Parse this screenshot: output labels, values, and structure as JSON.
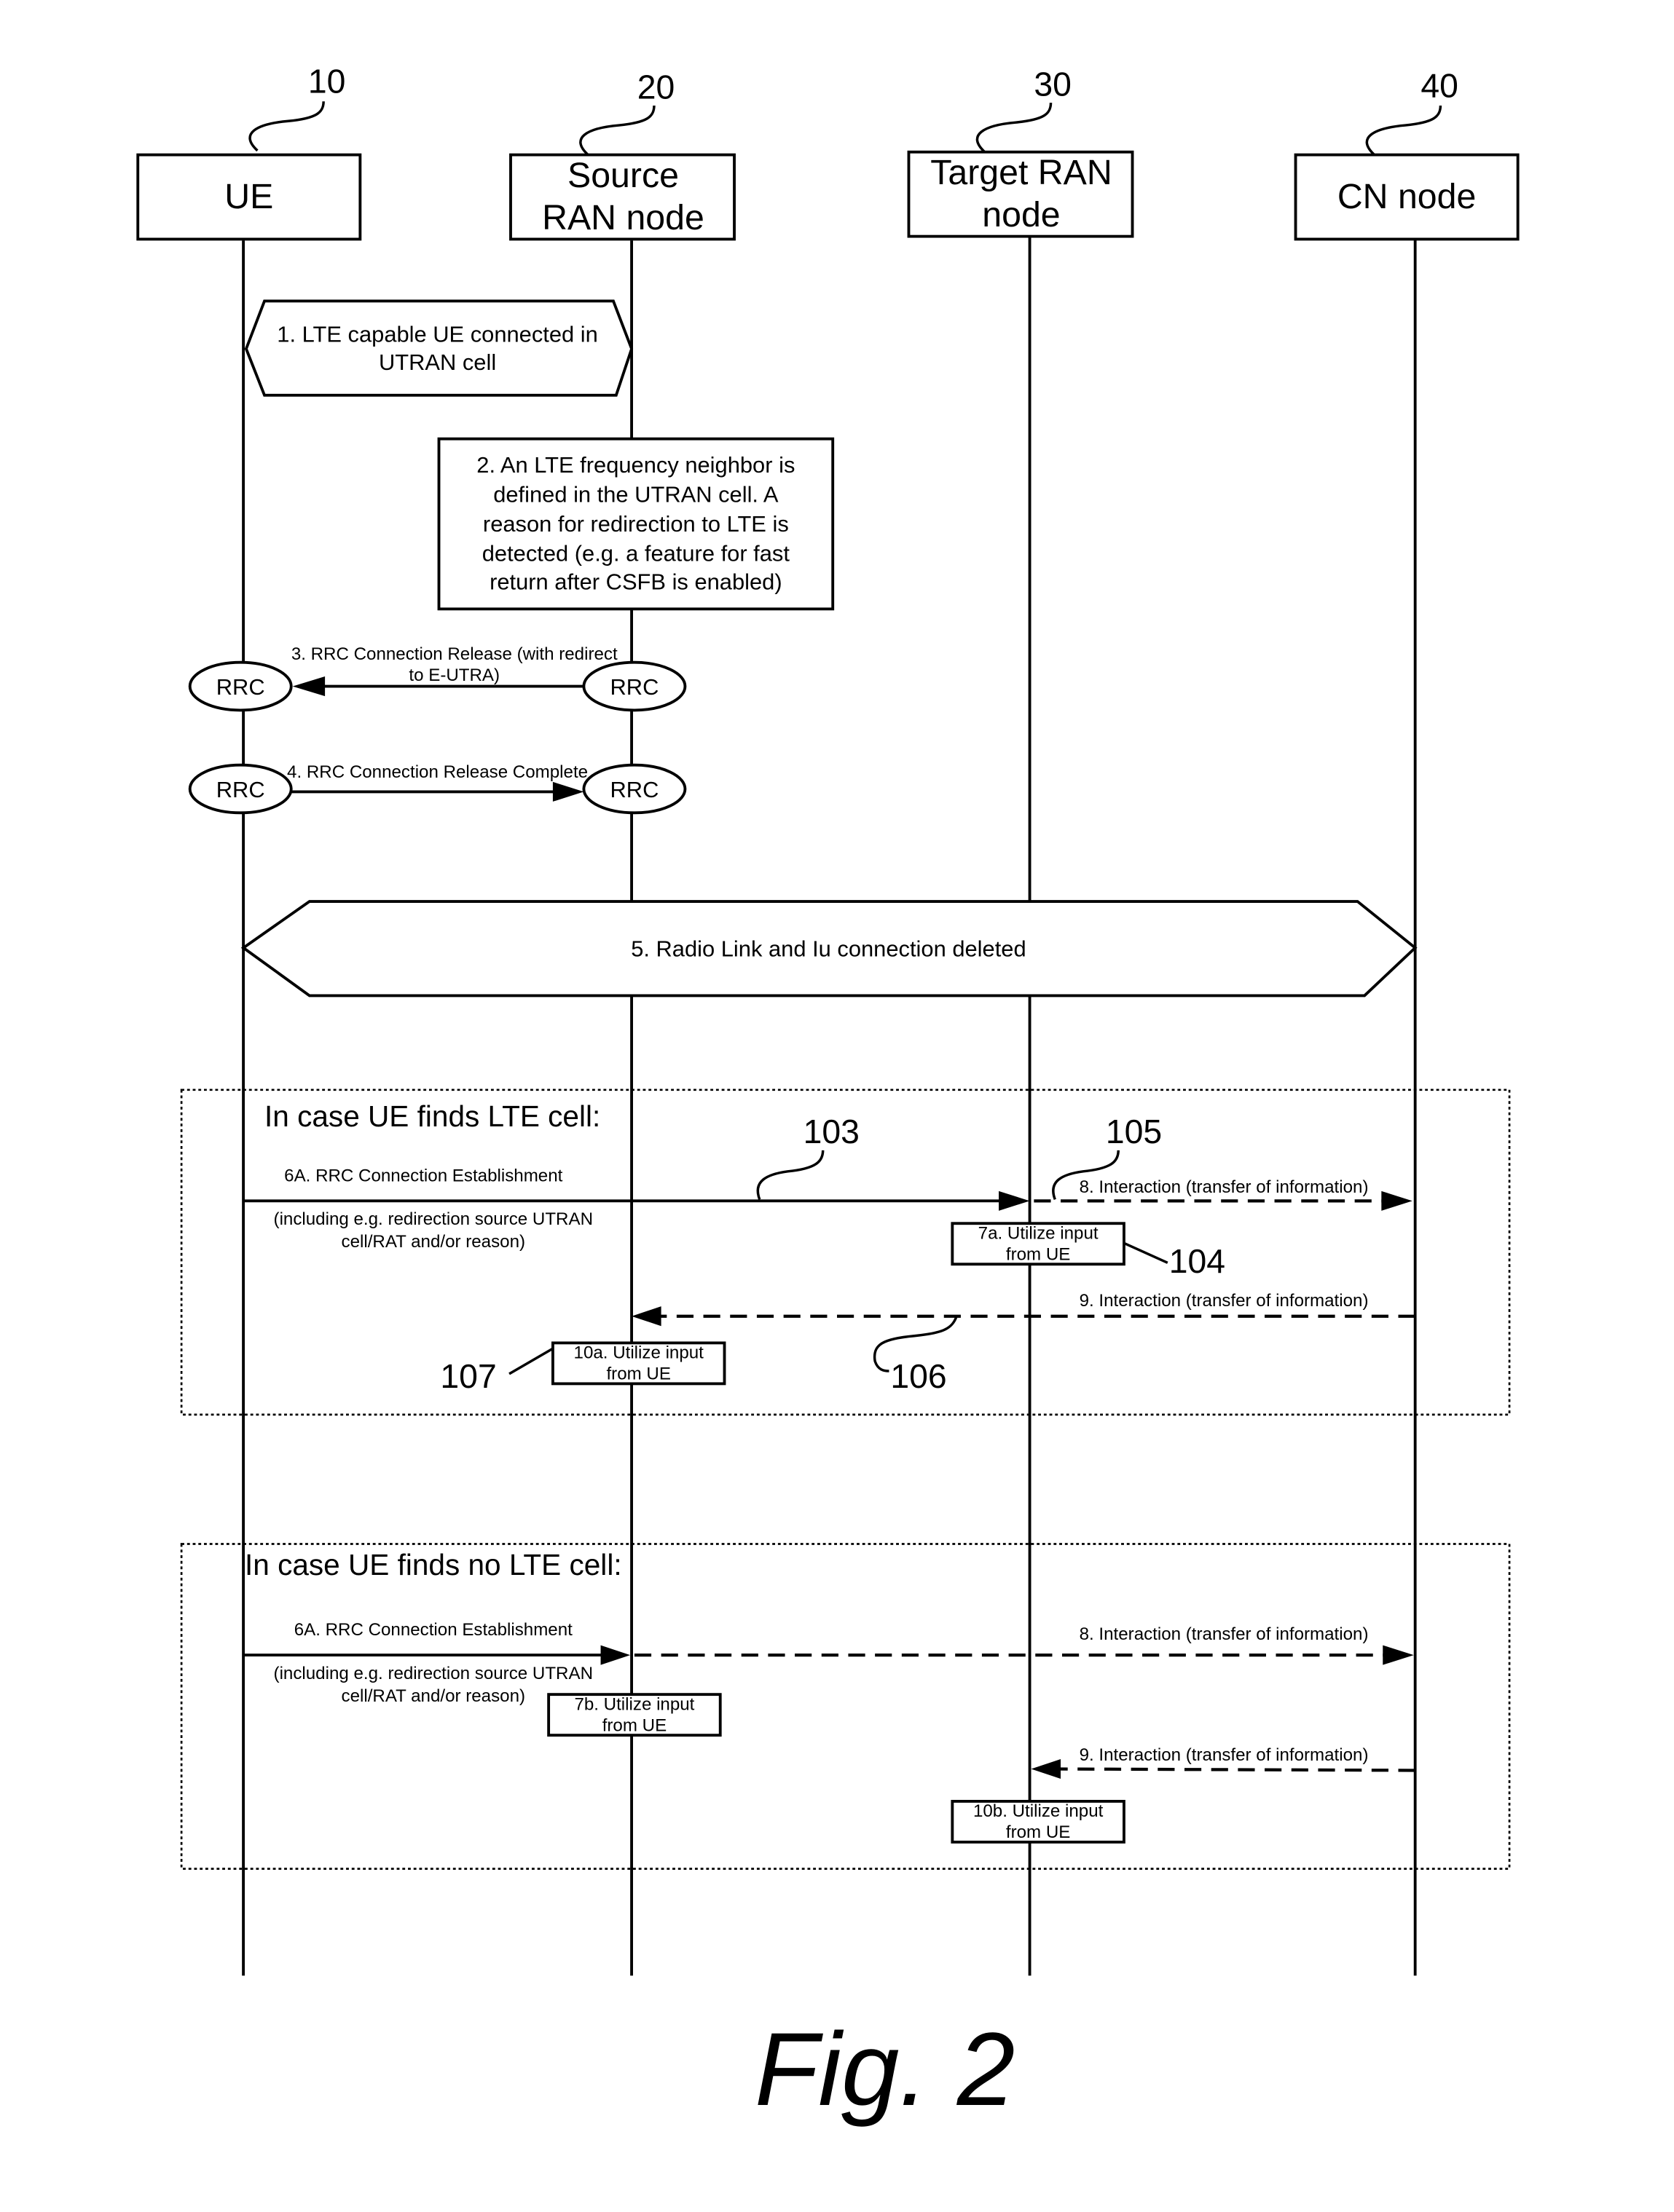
{
  "figure_label": "Fig. 2",
  "entities": [
    {
      "ref": "10",
      "name_lines": [
        "UE"
      ]
    },
    {
      "ref": "20",
      "name_lines": [
        "Source",
        "RAN node"
      ]
    },
    {
      "ref": "30",
      "name_lines": [
        "Target RAN",
        "node"
      ]
    },
    {
      "ref": "40",
      "name_lines": [
        "CN node"
      ]
    }
  ],
  "steps": {
    "s1": [
      "1. LTE capable UE connected in",
      "UTRAN cell"
    ],
    "s2": [
      "2. An LTE frequency neighbor is",
      "defined in the UTRAN cell. A",
      "reason for redirection to LTE is",
      "detected (e.g. a feature for fast",
      "return after CSFB is enabled)"
    ],
    "s3": [
      "3. RRC Connection Release (with redirect",
      "to E-UTRA)"
    ],
    "s4": "4. RRC Connection Release Complete",
    "rrc_label": "RRC",
    "s5": "5. Radio Link and Iu connection deleted"
  },
  "case_lte": {
    "title": "In case UE finds LTE cell:",
    "msg6a": "6A. RRC Connection Establishment",
    "msg6a_note": [
      "(including e.g. redirection source UTRAN",
      "cell/RAT and/or reason)"
    ],
    "msg8": "8. Interaction (transfer of information)",
    "box7a": [
      "7a. Utilize input",
      "from UE"
    ],
    "msg9": "9. Interaction (transfer of information)",
    "box10a": [
      "10a. Utilize input",
      "from UE"
    ],
    "refs": {
      "r103": "103",
      "r104": "104",
      "r105": "105",
      "r106": "106",
      "r107": "107"
    }
  },
  "case_no_lte": {
    "title": "In case UE finds no LTE cell:",
    "msg6a": "6A. RRC Connection Establishment",
    "msg6a_note": [
      "(including e.g. redirection source UTRAN",
      "cell/RAT and/or reason)"
    ],
    "msg8": "8. Interaction (transfer of information)",
    "box7b": [
      "7b. Utilize input",
      "from UE"
    ],
    "msg9": "9. Interaction (transfer of information)",
    "box10b": [
      "10b. Utilize input",
      "from UE"
    ]
  }
}
